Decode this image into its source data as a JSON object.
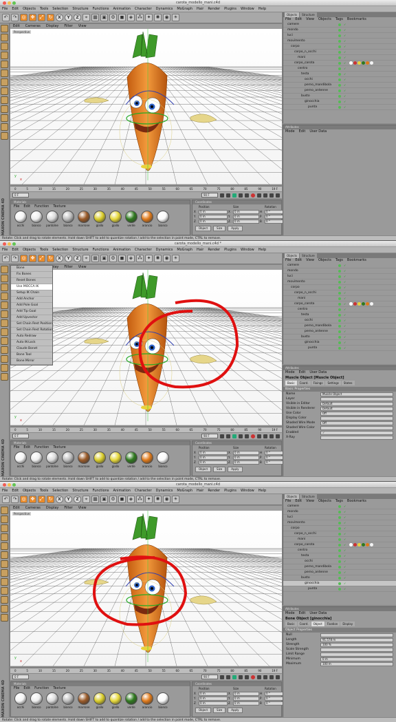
{
  "window_title": "carota_modello_mani.c4d",
  "window_title_modified": "carota_modello_mani.c4d *",
  "main_menu": [
    "File",
    "Edit",
    "Objects",
    "Tools",
    "Selection",
    "Structure",
    "Functions",
    "Animation",
    "Character",
    "Dynamics",
    "MoGraph",
    "Hair",
    "Render",
    "Plugins",
    "Window",
    "Help"
  ],
  "viewport_menu": [
    "Edit",
    "Cameras",
    "Display",
    "Filter",
    "View"
  ],
  "viewport_label": "Perspective",
  "timeline_ticks": [
    "0",
    "5",
    "10",
    "15",
    "20",
    "25",
    "30",
    "35",
    "40",
    "45",
    "50",
    "55",
    "60",
    "65",
    "70",
    "75",
    "80",
    "85",
    "90"
  ],
  "timeline_end": "19 F",
  "play": {
    "start": "0 F",
    "end": "90 F"
  },
  "materials_panel": {
    "title": "Materials",
    "menu": [
      "File",
      "Edit",
      "Function",
      "Texture"
    ],
    "items": [
      {
        "name": "occhi",
        "color": "#f4f4f4"
      },
      {
        "name": "bianco",
        "color": "#eeeeee"
      },
      {
        "name": "pantolne",
        "color": "#dadada"
      },
      {
        "name": "bianco",
        "color": "#bdbdbd"
      },
      {
        "name": "marrone",
        "color": "#9a5a28"
      },
      {
        "name": "giallo",
        "color": "#d9cc2a"
      },
      {
        "name": "giallo",
        "color": "#e6d83a"
      },
      {
        "name": "verde",
        "color": "#2f7a1e"
      },
      {
        "name": "arancio",
        "color": "#e07a1a"
      },
      {
        "name": "bianco",
        "color": "#fafafa"
      }
    ]
  },
  "coordinates": {
    "title": "Coordinates",
    "headers": [
      "Position",
      "Size",
      "Rotation"
    ],
    "rows": [
      {
        "axis": "X",
        "pos": "0 m",
        "size": "0 m",
        "rot_axis": "H",
        "rot": "0 °"
      },
      {
        "axis": "Y",
        "pos": "0 m",
        "size": "0 m",
        "rot_axis": "P",
        "rot": "0 °"
      },
      {
        "axis": "Z",
        "pos": "0 m",
        "size": "0 m",
        "rot_axis": "B",
        "rot": "0 °"
      }
    ],
    "mode": "Object",
    "size_mode": "Size",
    "apply": "Apply"
  },
  "status": "Rotate: Click and drag to rotate elements. Hold down SHIFT to add to quantize rotation / add to the selection in point mode, CTRL to remove.",
  "objects_panel": {
    "tabs": [
      "Objects",
      "Structure"
    ],
    "menu": [
      "File",
      "Edit",
      "View",
      "Objects",
      "Tags",
      "Bookmarks"
    ],
    "items": [
      {
        "name": "camere",
        "level": 0
      },
      {
        "name": "mondo",
        "level": 0
      },
      {
        "name": "luci",
        "level": 0
      },
      {
        "name": "movimento",
        "level": 0
      },
      {
        "name": "corpo",
        "level": 1
      },
      {
        "name": "corpo_n_occhi",
        "level": 2
      },
      {
        "name": "mani",
        "level": 3
      },
      {
        "name": "corpo_carota",
        "level": 2
      },
      {
        "name": "centro",
        "level": 3
      },
      {
        "name": "testa",
        "level": 4
      },
      {
        "name": "occhi",
        "level": 5
      },
      {
        "name": "perno_mandibola",
        "level": 5
      },
      {
        "name": "perno_antenne",
        "level": 5
      },
      {
        "name": "busto",
        "level": 4
      },
      {
        "name": "ginocchia",
        "level": 5
      },
      {
        "name": "punta",
        "level": 6
      }
    ]
  },
  "attributes": {
    "title": "Attributes",
    "menu": [
      "Mode",
      "Edit",
      "User Data"
    ]
  },
  "context_menu": {
    "items": [
      "Bone",
      "Fix Bones",
      "Reset Bones",
      "Use MOCCA IK",
      "Setup IK Chain",
      "Add Anchor",
      "Add Pole Goal",
      "Add Tip Goal",
      "Add Upvector",
      "Set Chain Rest Position",
      "Set Chain Rest Rotation",
      "Auto Redraw",
      "Auto IK-Lock",
      "Claude Bonet",
      "Bone Tool",
      "Bone Mirror"
    ],
    "selected": "Use MOCCA IK"
  },
  "muscle": {
    "title": "Muscle Object [Muscle Object]",
    "tabs": [
      "Basic",
      "Coord.",
      "Fixings",
      "Settings",
      "States"
    ],
    "section": "Basic Properties",
    "fields": [
      {
        "label": "Name",
        "value": "Muscle Object"
      },
      {
        "label": "Layer",
        "value": ""
      },
      {
        "label": "Visible in Editor",
        "value": "Default"
      },
      {
        "label": "Visible in Renderer",
        "value": "Default"
      },
      {
        "label": "Use Color",
        "value": "Off"
      },
      {
        "label": "Display Color",
        "value": ""
      },
      {
        "label": "Shaded Wire Mode",
        "value": "Off"
      },
      {
        "label": "Shaded Wire Color",
        "value": ""
      },
      {
        "label": "Enabled",
        "value": "✓"
      },
      {
        "label": "X-Ray",
        "value": ""
      }
    ]
  },
  "bone": {
    "title": "Bone Object [ginocchia]",
    "tabs": [
      "Basic",
      "Coord.",
      "Object",
      "Fixation",
      "Display"
    ],
    "section": "Object Properties",
    "fields": [
      {
        "label": "Null",
        "value": ""
      },
      {
        "label": "Length",
        "value": "91.578 m"
      },
      {
        "label": "Strength",
        "value": "100 %"
      },
      {
        "label": "Scale Strength",
        "value": ""
      },
      {
        "label": "Limit Range",
        "value": ""
      },
      {
        "label": "Minimum",
        "value": "0 m"
      },
      {
        "label": "Maximum",
        "value": "100 m"
      }
    ]
  },
  "logo": "MAXON CINEMA 4D"
}
